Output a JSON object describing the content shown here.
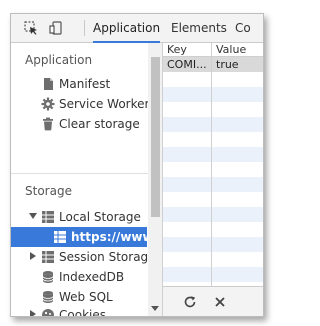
{
  "toolbar": {
    "icons": [
      "inspect-element-icon",
      "device-toggle-icon"
    ],
    "tabs": [
      {
        "label": "Application",
        "active": true
      },
      {
        "label": "Elements",
        "active": false
      },
      {
        "label": "Co",
        "active": false
      }
    ]
  },
  "sidebar": {
    "application_heading": "Application",
    "application_items": [
      {
        "label": "Manifest",
        "icon": "document-icon"
      },
      {
        "label": "Service Workers",
        "icon": "gear-icon"
      },
      {
        "label": "Clear storage",
        "icon": "trash-icon"
      }
    ],
    "storage_heading": "Storage",
    "storage_items": [
      {
        "label": "Local Storage",
        "icon": "grid-icon",
        "expanded": true
      },
      {
        "label": "https://www.b",
        "icon": "grid-icon",
        "selected": true
      },
      {
        "label": "Session Storage",
        "icon": "grid-icon",
        "expanded": false
      },
      {
        "label": "IndexedDB",
        "icon": "database-icon"
      },
      {
        "label": "Web SQL",
        "icon": "database-icon"
      },
      {
        "label": "Cookies",
        "icon": "cookie-icon",
        "expanded": false
      }
    ]
  },
  "table": {
    "columns": [
      "Key",
      "Value"
    ],
    "rows": [
      {
        "key": "COMI...",
        "value": "true"
      }
    ],
    "selected_row_color": "#d9d9d9",
    "stripe_color": "#eaf1fb"
  },
  "bottom_bar": {
    "icons": [
      "refresh-icon",
      "delete-icon"
    ]
  },
  "colors": {
    "accent": "#3879d9",
    "toolbar_bg": "#f3f3f3"
  }
}
